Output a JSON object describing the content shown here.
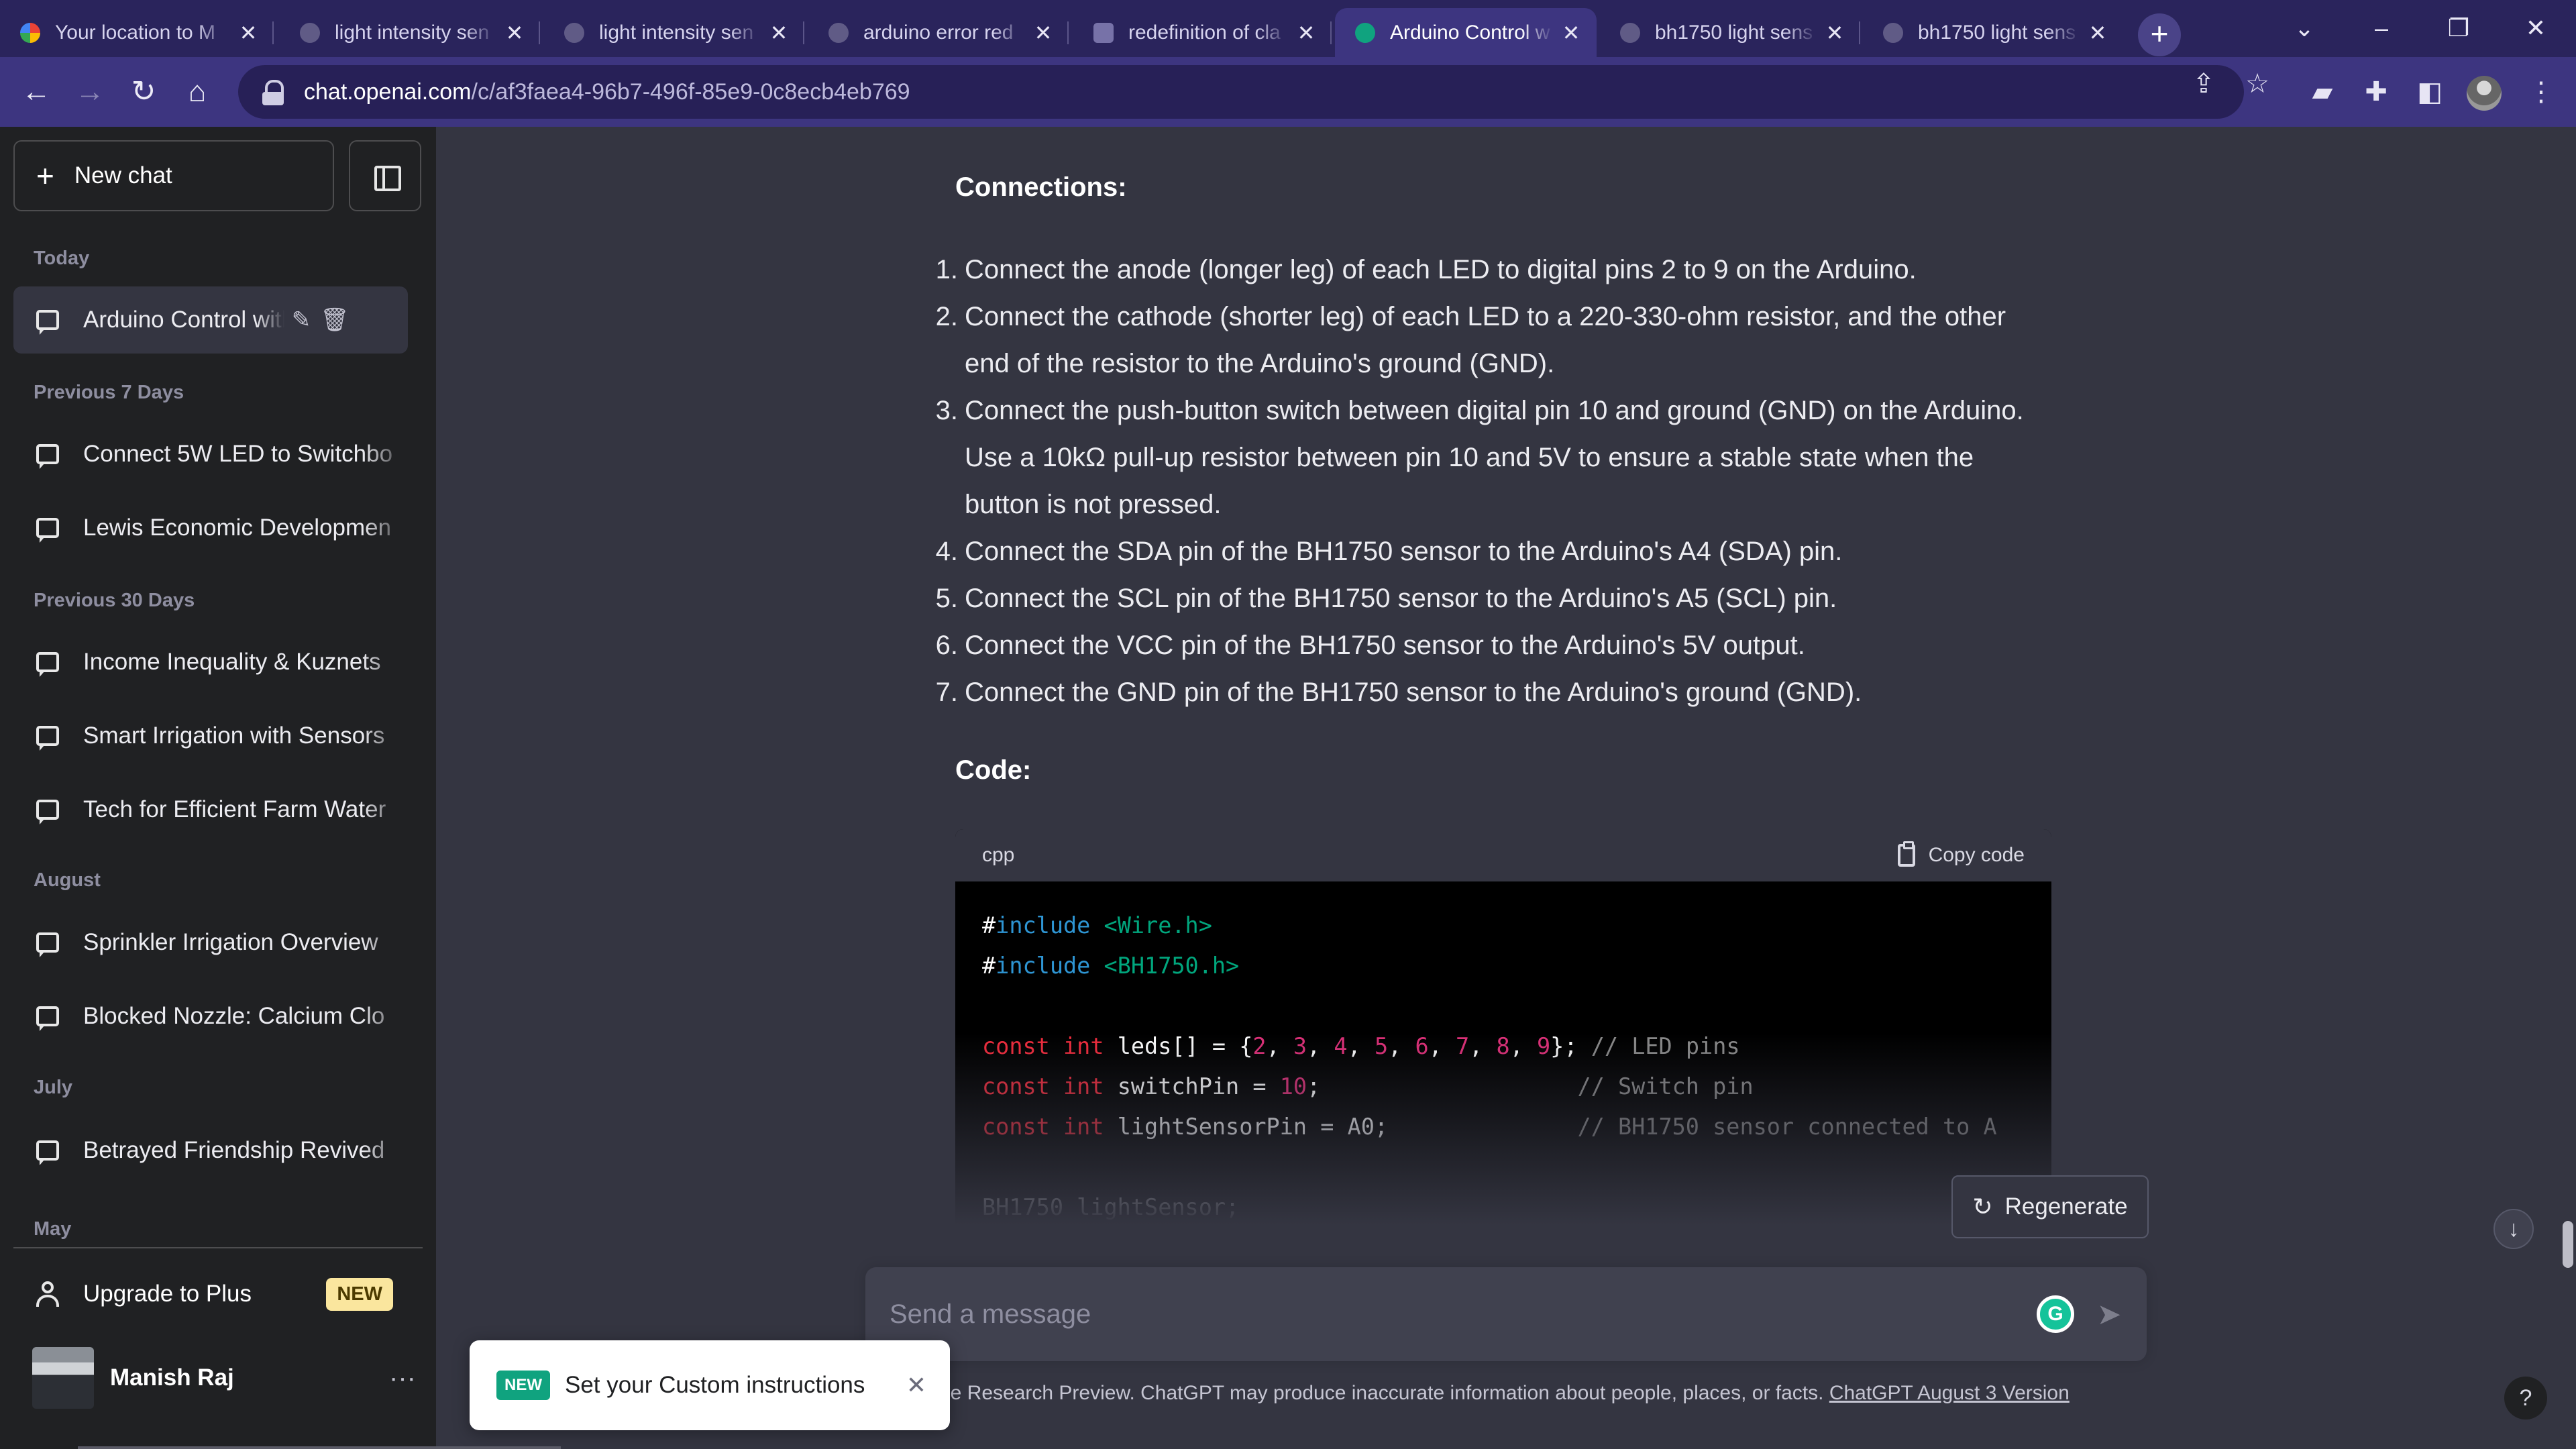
{
  "browser": {
    "tabs": [
      {
        "title": "Your location to M",
        "icon": "maps-icon"
      },
      {
        "title": "light intensity sen",
        "icon": "globe-icon"
      },
      {
        "title": "light intensity sen",
        "icon": "globe-icon"
      },
      {
        "title": "arduino error red",
        "icon": "globe-icon"
      },
      {
        "title": "redefinition of cla",
        "icon": "robot-icon"
      },
      {
        "title": "Arduino Control w",
        "icon": "chatgpt-icon",
        "active": true
      },
      {
        "title": "bh1750 light sens",
        "icon": "globe-icon"
      },
      {
        "title": "bh1750 light sens",
        "icon": "globe-icon"
      }
    ],
    "url_host": "chat.openai.com",
    "url_path": "/c/af3faea4-96b7-496f-85e9-0c8ecb4eb769"
  },
  "sidebar": {
    "new_chat_label": "New chat",
    "sections": [
      {
        "label": "Today",
        "items": [
          "Arduino Control with S"
        ]
      },
      {
        "label": "Previous 7 Days",
        "items": [
          "Connect 5W LED to Switchbo",
          "Lewis Economic Developmen"
        ]
      },
      {
        "label": "Previous 30 Days",
        "items": [
          "Income Inequality & Kuznets",
          "Smart Irrigation with Sensors",
          "Tech for Efficient Farm Water"
        ]
      },
      {
        "label": "August",
        "items": [
          "Sprinkler Irrigation Overview",
          "Blocked Nozzle: Calcium Clo"
        ]
      },
      {
        "label": "July",
        "items": [
          "Betrayed Friendship Revived"
        ]
      },
      {
        "label": "May",
        "items": []
      }
    ],
    "upgrade_label": "Upgrade to Plus",
    "upgrade_badge": "NEW",
    "user_name": "Manish Raj"
  },
  "content": {
    "connections_heading": "Connections:",
    "steps": [
      "Connect the anode (longer leg) of each LED to digital pins 2 to 9 on the Arduino.",
      "Connect the cathode (shorter leg) of each LED to a 220-330-ohm resistor, and the other end of the resistor to the Arduino's ground (GND).",
      "Connect the push-button switch between digital pin 10 and ground (GND) on the Arduino. Use a 10kΩ pull-up resistor between pin 10 and 5V to ensure a stable state when the button is not pressed.",
      "Connect the SDA pin of the BH1750 sensor to the Arduino's A4 (SDA) pin.",
      "Connect the SCL pin of the BH1750 sensor to the Arduino's A5 (SCL) pin.",
      "Connect the VCC pin of the BH1750 sensor to the Arduino's 5V output.",
      "Connect the GND pin of the BH1750 sensor to the Arduino's ground (GND)."
    ],
    "code_heading": "Code:",
    "code_lang": "cpp",
    "copy_label": "Copy code",
    "code_lines": [
      "#include <Wire.h>",
      "#include <BH1750.h>",
      "",
      "const int leds[] = {2, 3, 4, 5, 6, 7, 8, 9}; // LED pins",
      "const int switchPin = 10;                   // Switch pin",
      "const int lightSensorPin = A0;              // BH1750 sensor connected to A",
      "",
      "BH1750 lightSensor;"
    ]
  },
  "composer": {
    "regenerate_label": "Regenerate",
    "placeholder": "Send a message",
    "disclaimer": "ree Research Preview. ChatGPT may produce inaccurate information about people, places, or facts.",
    "version_link": "ChatGPT August 3 Version"
  },
  "toast": {
    "badge": "NEW",
    "text": "Set your Custom instructions"
  }
}
